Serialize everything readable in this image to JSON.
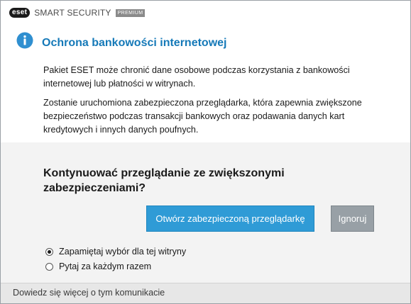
{
  "app": {
    "brand_badge": "eset",
    "product_name": "SMART SECURITY",
    "edition": "PREMIUM"
  },
  "dialog": {
    "title": "Ochrona bankowości internetowej",
    "paragraph_1": "Pakiet ESET może chronić dane osobowe podczas korzystania z bankowości internetowej lub płatności w witrynach.",
    "paragraph_2": "Zostanie uruchomiona zabezpieczona przeglądarka, która zapewnia zwiększone bezpieczeństwo podczas transakcji bankowych oraz podawania danych kart kredytowych i innych danych poufnych.",
    "question": "Kontynuować przeglądanie ze zwiększonymi zabezpieczeniami?",
    "primary_button": "Otwórz zabezpieczoną przeglądarkę",
    "secondary_button": "Ignoruj",
    "options": [
      {
        "label": "Zapamiętaj wybór dla tej witryny",
        "selected": true
      },
      {
        "label": "Pytaj za każdym razem",
        "selected": false
      }
    ],
    "footer_link": "Dowiedz się więcej o tym komunikacie"
  },
  "colors": {
    "accent": "#1579b8",
    "primary_button": "#2f9bd6",
    "secondary_button": "#98a0a6",
    "grey_area": "#f3f3f3",
    "footer": "#e7e7e7"
  },
  "icons": {
    "header": "info-icon"
  }
}
